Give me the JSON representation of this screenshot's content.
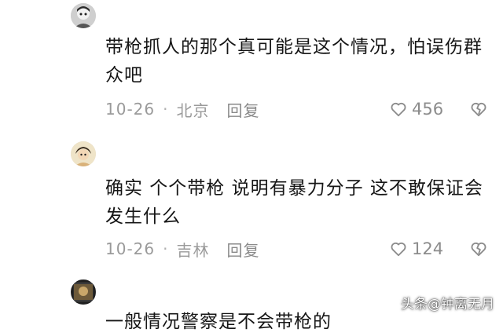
{
  "comments": [
    {
      "text": "带枪抓人的那个真可能是这个情况，怕误伤群众吧",
      "date": "10-26",
      "location": "北京",
      "reply_label": "回复",
      "likes": "456"
    },
    {
      "text": "确实 个个带枪 说明有暴力分子 这不敢保证会发生什么",
      "date": "10-26",
      "location": "吉林",
      "reply_label": "回复",
      "likes": "124"
    },
    {
      "text": "一般情况警察是不会带枪的"
    }
  ],
  "separator": "·",
  "watermark": "头条@钟离无月",
  "icons": {
    "like": "heart-icon",
    "dislike": "broken-heart-icon"
  },
  "colors": {
    "meta_text": "#9a9a9a",
    "body_text": "#161616"
  }
}
